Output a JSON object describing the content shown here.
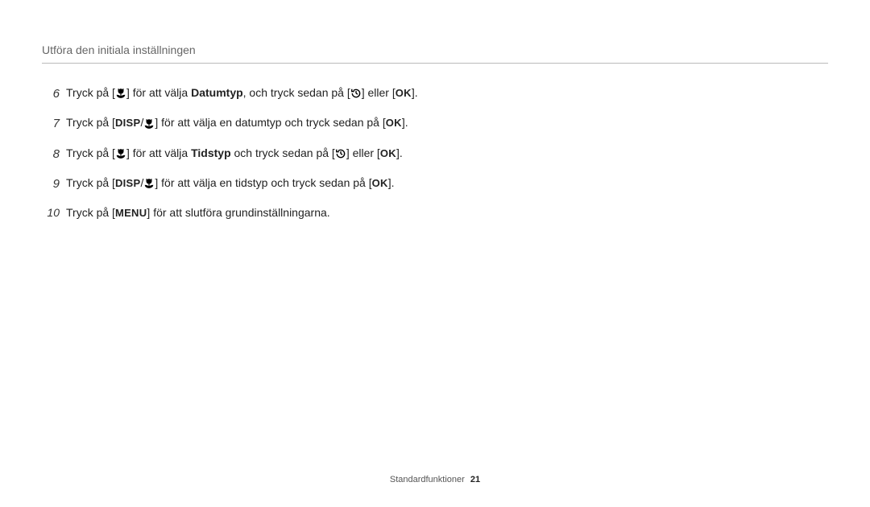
{
  "header": {
    "title": "Utföra den initiala inställningen"
  },
  "steps": [
    {
      "num": "6",
      "pieces": [
        {
          "t": "text",
          "v": "Tryck på ["
        },
        {
          "t": "icon",
          "v": "macro"
        },
        {
          "t": "text",
          "v": "] för att välja  "
        },
        {
          "t": "bold",
          "v": "Datumtyp"
        },
        {
          "t": "text",
          "v": ", och tryck sedan på ["
        },
        {
          "t": "icon",
          "v": "timer"
        },
        {
          "t": "text",
          "v": "] eller ["
        },
        {
          "t": "ok",
          "v": "OK"
        },
        {
          "t": "text",
          "v": "]."
        }
      ]
    },
    {
      "num": "7",
      "pieces": [
        {
          "t": "text",
          "v": "Tryck på ["
        },
        {
          "t": "disp",
          "v": "DISP"
        },
        {
          "t": "text",
          "v": "/"
        },
        {
          "t": "icon",
          "v": "macro"
        },
        {
          "t": "text",
          "v": "] för att välja en datumtyp och tryck sedan på ["
        },
        {
          "t": "ok",
          "v": "OK"
        },
        {
          "t": "text",
          "v": "]."
        }
      ]
    },
    {
      "num": "8",
      "pieces": [
        {
          "t": "text",
          "v": "Tryck på ["
        },
        {
          "t": "icon",
          "v": "macro"
        },
        {
          "t": "text",
          "v": "] för att välja "
        },
        {
          "t": "bold",
          "v": "Tidstyp"
        },
        {
          "t": "text",
          "v": " och tryck sedan på ["
        },
        {
          "t": "icon",
          "v": "timer"
        },
        {
          "t": "text",
          "v": "] eller ["
        },
        {
          "t": "ok",
          "v": "OK"
        },
        {
          "t": "text",
          "v": "]."
        }
      ]
    },
    {
      "num": "9",
      "pieces": [
        {
          "t": "text",
          "v": "Tryck på ["
        },
        {
          "t": "disp",
          "v": "DISP"
        },
        {
          "t": "text",
          "v": "/"
        },
        {
          "t": "icon",
          "v": "macro"
        },
        {
          "t": "text",
          "v": "] för att välja en tidstyp och tryck sedan på ["
        },
        {
          "t": "ok",
          "v": "OK"
        },
        {
          "t": "text",
          "v": "]."
        }
      ]
    },
    {
      "num": "10",
      "pieces": [
        {
          "t": "text",
          "v": "Tryck på ["
        },
        {
          "t": "menu",
          "v": "MENU"
        },
        {
          "t": "text",
          "v": "] för att slutföra grundinställningarna."
        }
      ]
    }
  ],
  "footer": {
    "section": "Standardfunktioner",
    "page": "21"
  }
}
